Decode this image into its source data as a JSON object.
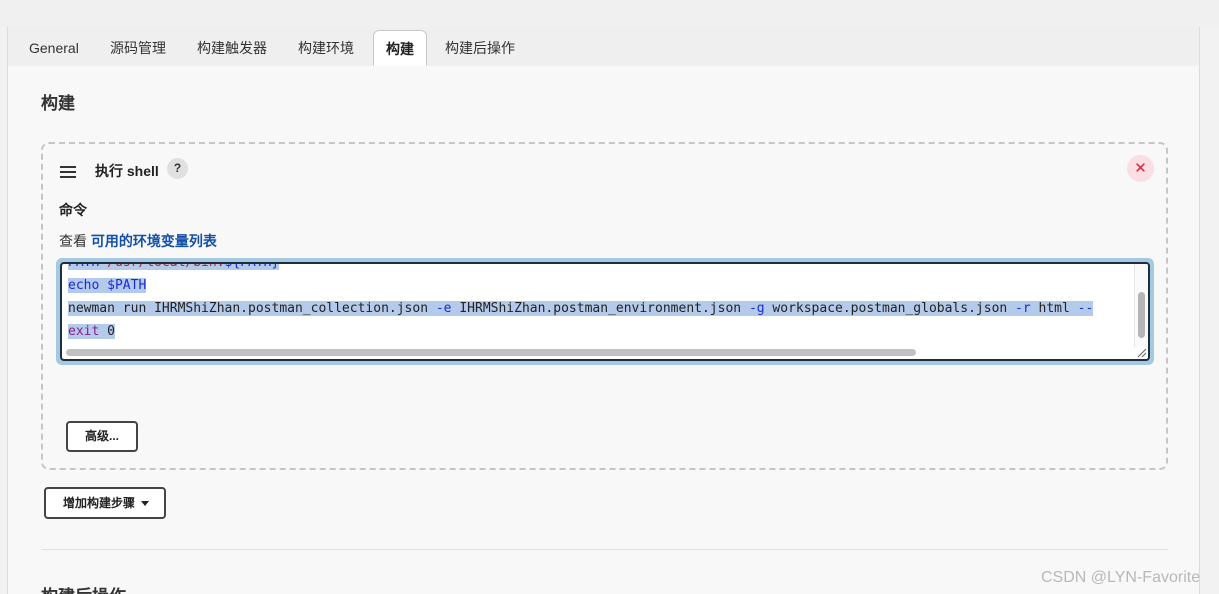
{
  "tabs": [
    {
      "label": "General",
      "active": false
    },
    {
      "label": "源码管理",
      "active": false
    },
    {
      "label": "构建触发器",
      "active": false
    },
    {
      "label": "构建环境",
      "active": false
    },
    {
      "label": "构建",
      "active": true
    },
    {
      "label": "构建后操作",
      "active": false
    }
  ],
  "build_section": {
    "title": "构建"
  },
  "step": {
    "title": "执行 shell",
    "help_label": "?",
    "close_label": "✕",
    "command_label": "命令",
    "env_prefix": "查看",
    "env_link": "可用的环境变量列表",
    "code_lines": [
      {
        "parts": [
          {
            "text": "PATH=",
            "style": "c-var"
          },
          {
            "text": "/usr/local/bin:",
            "style": "c-str"
          },
          {
            "text": "${PATH}",
            "style": "c-var"
          }
        ]
      },
      {
        "parts": [
          {
            "text": "echo ",
            "style": "c-kw"
          },
          {
            "text": "$PATH",
            "style": "c-var"
          }
        ]
      },
      {
        "parts": [
          {
            "text": "newman run IHRMShiZhan.postman_collection.json ",
            "style": "c-plain"
          },
          {
            "text": "-e",
            "style": "c-flag"
          },
          {
            "text": " IHRMShiZhan.postman_environment.json ",
            "style": "c-plain"
          },
          {
            "text": "-g",
            "style": "c-flag"
          },
          {
            "text": " workspace.postman_globals.json ",
            "style": "c-plain"
          },
          {
            "text": "-r",
            "style": "c-flag"
          },
          {
            "text": " html ",
            "style": "c-plain"
          },
          {
            "text": "--",
            "style": "c-flag"
          }
        ]
      },
      {
        "parts": [
          {
            "text": "exit",
            "style": "c-exit"
          },
          {
            "text": " 0",
            "style": "c-plain"
          }
        ]
      }
    ],
    "advanced_button": "高级..."
  },
  "add_step_button": "增加构建步骤",
  "post_build_section": {
    "title": "构建后操作"
  },
  "watermark": "CSDN @LYN-Favorite",
  "colors": {
    "selection": "#b3caeb",
    "focus_ring": "#a6c9e2",
    "link": "#1450a8",
    "close": "#d8243b"
  }
}
